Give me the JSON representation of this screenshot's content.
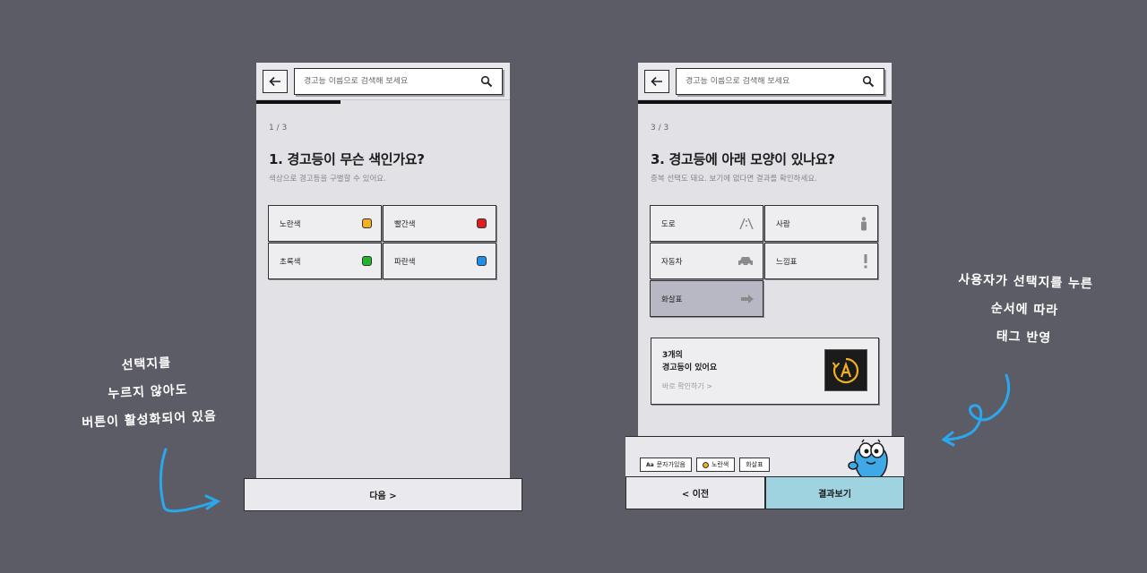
{
  "search": {
    "placeholder": "경고등 이름으로 검색해 보세요"
  },
  "screen1": {
    "step": "1 / 3",
    "progress": 0.33,
    "question": "1. 경고등이 무슨 색인가요?",
    "hint": "색상으로 경고등을 구별할 수 있어요.",
    "options": [
      {
        "label": "노란색",
        "color": "#f0b020"
      },
      {
        "label": "빨간색",
        "color": "#e01e1e"
      },
      {
        "label": "초록색",
        "color": "#22b42a"
      },
      {
        "label": "파란색",
        "color": "#1e8ee8"
      }
    ],
    "next_label": "다음 >"
  },
  "screen2": {
    "step": "3 / 3",
    "progress": 1.0,
    "question": "3. 경고등에 아래 모양이 있나요?",
    "hint": "중복 선택도 돼요. 보기에 없다면 결과를 확인하세요.",
    "options": [
      {
        "label": "도로",
        "icon": "road-icon",
        "glyph": "/\\"
      },
      {
        "label": "사람",
        "icon": "person-icon",
        "glyph": "♟"
      },
      {
        "label": "자동차",
        "icon": "car-icon",
        "glyph": "🚗"
      },
      {
        "label": "느낌표",
        "icon": "exclamation-icon",
        "glyph": "!"
      },
      {
        "label": "화살표",
        "icon": "arrow-icon",
        "glyph": "➔",
        "selected": true
      }
    ],
    "result": {
      "count_line1": "3개의",
      "count_line2": "경고등이 있어요",
      "link": "바로 확인하기 >"
    },
    "tags": [
      {
        "label": "문자가있음",
        "prefix": "Aa"
      },
      {
        "label": "노란색",
        "dot": "#f0b020"
      },
      {
        "label": "화살표"
      }
    ],
    "prev_label": "< 이전",
    "result_button_label": "결과보기",
    "result_button_color": "#9fd3e0"
  },
  "annotations": {
    "left": [
      "선택지를",
      "누르지 않아도",
      "버튼이 활성화되어 있음"
    ],
    "right": [
      "사용자가 선택지를 누른",
      "순서에 따라",
      "태그 반영"
    ]
  },
  "colors": {
    "background": "#5c5c66",
    "accent_arrow": "#2aa8ee"
  }
}
